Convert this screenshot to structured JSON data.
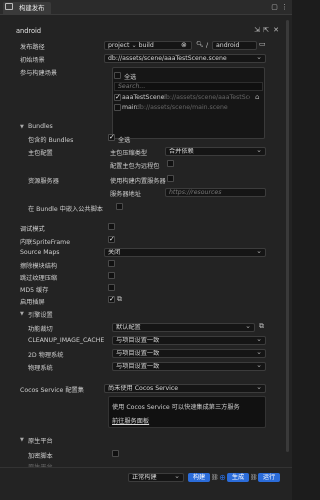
{
  "window": {
    "title": "构建发布"
  },
  "header": {
    "platform": "android"
  },
  "publish_path": {
    "label": "发布路径",
    "prefix": "project",
    "value": "build",
    "sep": "/",
    "platform": "android"
  },
  "start_scene": {
    "label": "初始场景",
    "value": "db://assets/scene/aaaTestScene.scene"
  },
  "scenes": {
    "label": "参与构建场景",
    "select_all": "全选",
    "search_placeholder": "Search...",
    "items": [
      {
        "name": "aaaTestScene",
        "path": "db://assets/scene/aaaTestScene",
        "checked": true
      },
      {
        "name": "main",
        "path": "db://assets/scene/main.scene",
        "checked": false
      }
    ]
  },
  "bundles": {
    "section": "Bundles",
    "include_label": "包含的 Bundles",
    "select_all": "全选",
    "main_pkg_label": "主包配置",
    "compress_type_label": "主包压缩类型",
    "compress_type_value": "合并依赖",
    "remote_label": "配置主包为远程包"
  },
  "resource_server": {
    "label": "资源服务器",
    "builtin_label": "使用构建内置服务器",
    "address_label": "服务器地址",
    "address_placeholder": "https://resources"
  },
  "inline_script_label": "在 Bundle 中嵌入公共脚本",
  "debug_label": "调试模式",
  "inline_sprite_label": "内联SpriteFrame",
  "source_maps": {
    "label": "Source Maps",
    "value": "关闭"
  },
  "erase_module_label": "擦除模块结构",
  "skip_compress_label": "跳过纹理压缩",
  "md5_label": "MD5 缓存",
  "splash_label": "启用插屏",
  "engine": {
    "section": "引擎设置",
    "rows": [
      {
        "label": "功能裁切",
        "value": "默认配置"
      },
      {
        "label": "CLEANUP_IMAGE_CACHE",
        "value": "与项目设置一致"
      },
      {
        "label": "2D 物理系统",
        "value": "与项目设置一致"
      },
      {
        "label": "物理系统",
        "value": "与项目设置一致"
      }
    ]
  },
  "cocos_service": {
    "label": "Cocos Service 配置集",
    "value": "尚未使用 Cocos Service",
    "info": "使用 Cocos Service 可以快速集成第三方服务",
    "link": "前往服务面板"
  },
  "native": {
    "section": "原生平台",
    "encrypt_label": "加密脚本",
    "next_label": "原生平台"
  },
  "footer": {
    "mode": "正常构建",
    "build": "构建",
    "make": "生成",
    "run": "运行"
  },
  "colors": {
    "accent": "#2b6cd9",
    "background": "#232323"
  }
}
